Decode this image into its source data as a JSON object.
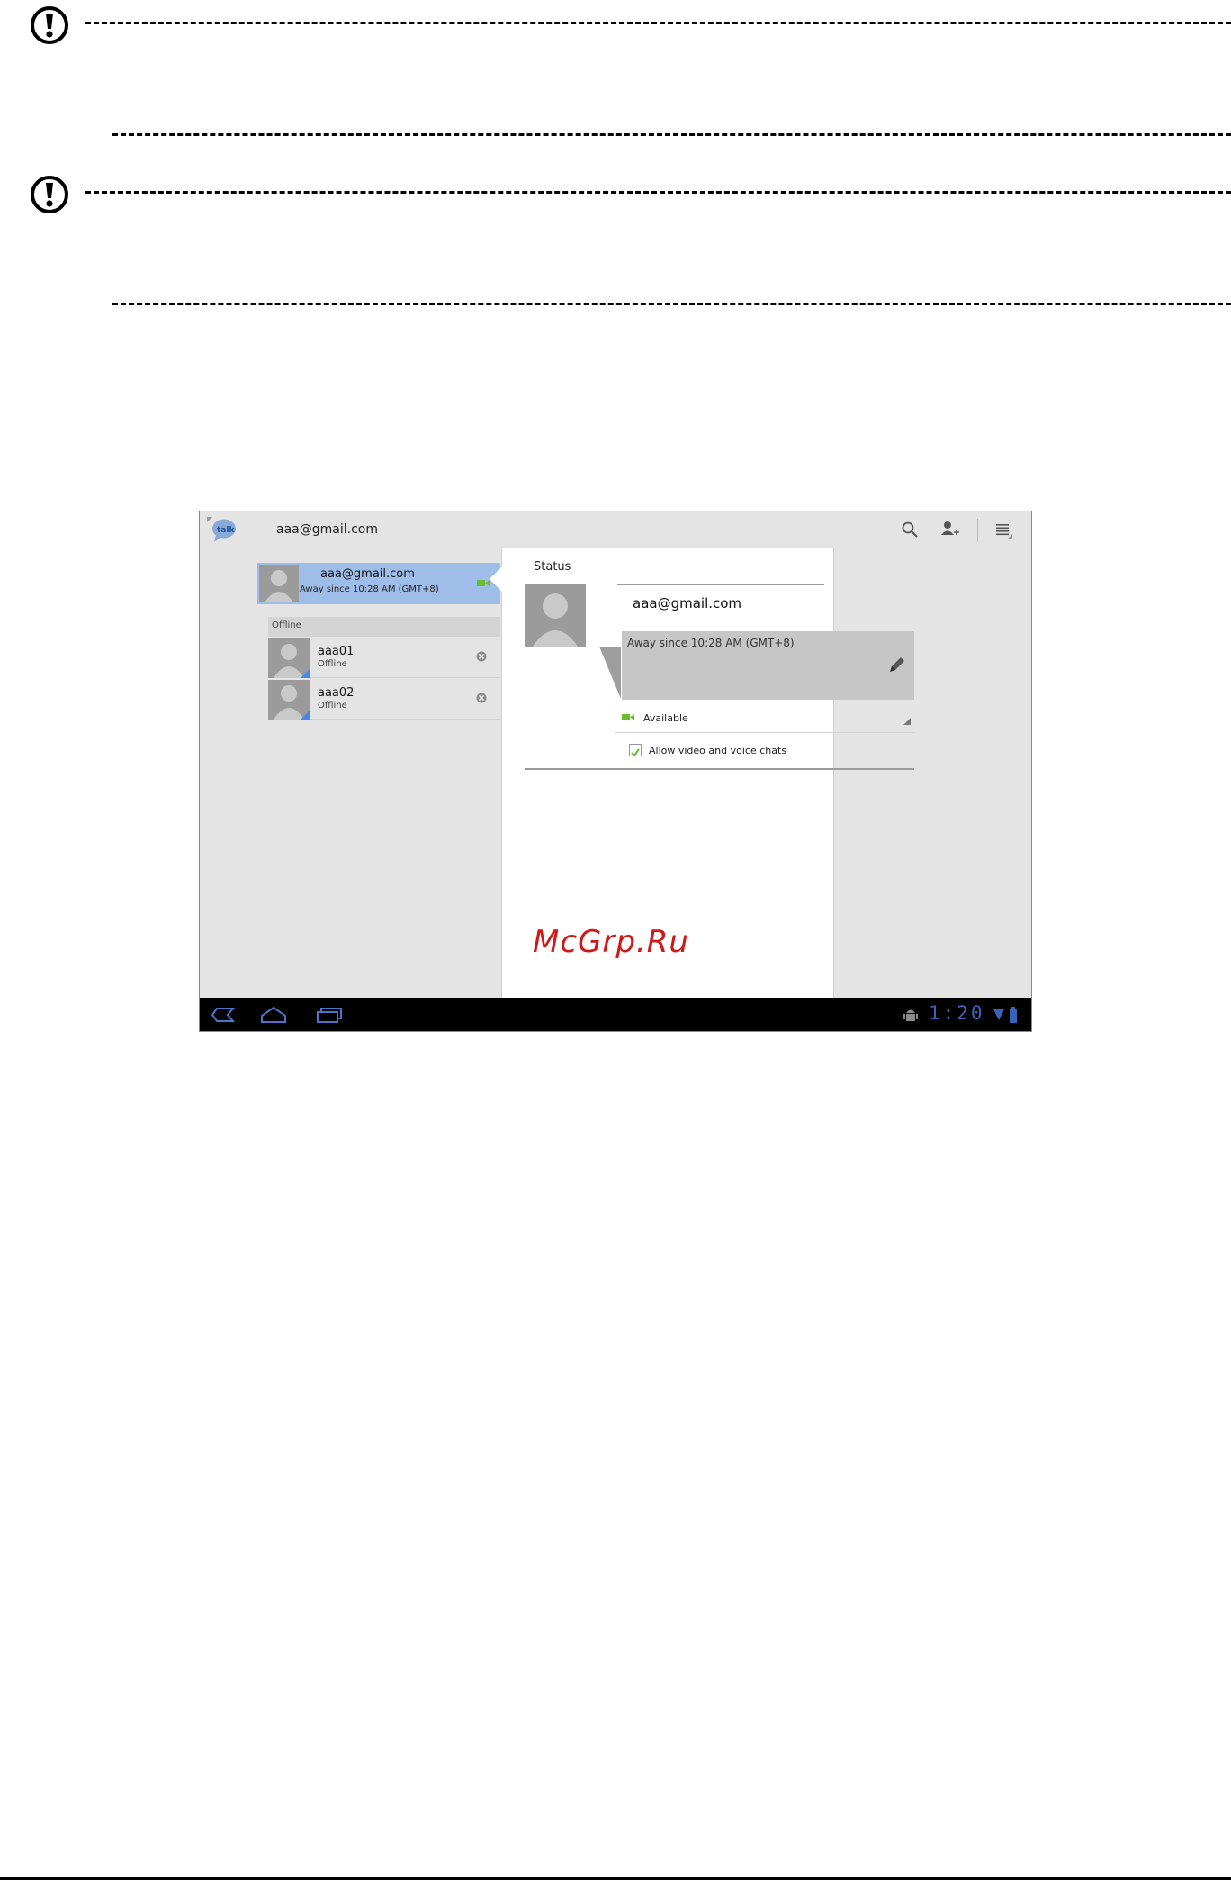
{
  "app": {
    "logo_text": "talk",
    "account": "aaa@gmail.com"
  },
  "self": {
    "name": "aaa@gmail.com",
    "status": "Away since 10:28 AM (GMT+8)"
  },
  "contacts": {
    "group_label": "Offline",
    "items": [
      {
        "name": "aaa01",
        "status": "Offline"
      },
      {
        "name": "aaa02",
        "status": "Offline"
      }
    ]
  },
  "panel": {
    "title": "Status",
    "name": "aaa@gmail.com",
    "status_message": "Away since 10:28 AM (GMT+8)",
    "availability": "Available",
    "allow_label": "Allow video and voice chats",
    "allow_checked": true
  },
  "watermark": "McGrp.Ru",
  "system_bar": {
    "time": "1:20"
  },
  "colors": {
    "selected_row": "#9fbde9",
    "accent_blue": "#4a86e8",
    "available_green": "#6dbb2e",
    "watermark_red": "#d01818"
  }
}
